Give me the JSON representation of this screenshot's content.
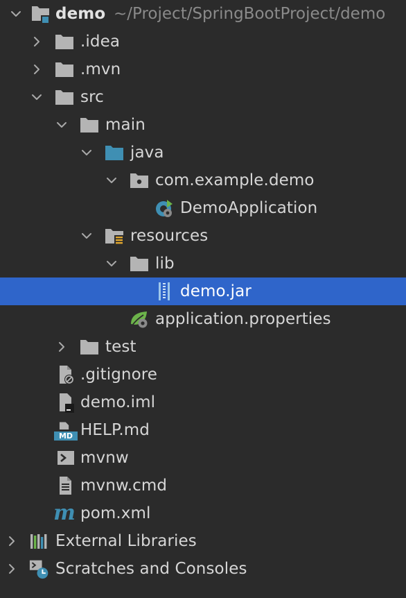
{
  "project": {
    "name": "demo",
    "path": "~/Project/SpringBootProject/demo"
  },
  "tree": {
    "idea": ".idea",
    "mvn": ".mvn",
    "src": "src",
    "main": "main",
    "java": "java",
    "package": "com.example.demo",
    "app_class": "DemoApplication",
    "resources": "resources",
    "lib": "lib",
    "jar": "demo.jar",
    "props": "application.properties",
    "test": "test",
    "gitignore": ".gitignore",
    "iml": "demo.iml",
    "help": "HELP.md",
    "help_badge": "MD",
    "mvnw": "mvnw",
    "mvnw_cmd": "mvnw.cmd",
    "pom": "pom.xml",
    "pom_badge": "m",
    "external_libs": "External Libraries",
    "scratches": "Scratches and Consoles"
  },
  "colors": {
    "background": "#2b2b2b",
    "selection": "#2f65ca",
    "folder": "#b4b4b4",
    "source_folder": "#3f8fb3",
    "resource_accent": "#e0a72e",
    "spring_green": "#6cb34a",
    "text": "#d6d6d6",
    "muted": "#8a8a8a"
  },
  "icons": {
    "module": "module-folder-icon",
    "folder": "folder-icon",
    "source_folder": "source-folder-icon",
    "package": "package-icon",
    "spring_class": "spring-boot-class-icon",
    "resources_folder": "resources-folder-icon",
    "jar": "jar-archive-icon",
    "spring_properties": "spring-properties-icon",
    "file": "file-icon",
    "markdown": "markdown-icon",
    "terminal": "terminal-script-icon",
    "maven": "maven-icon",
    "libraries": "external-libraries-icon",
    "scratches": "scratches-icon"
  }
}
